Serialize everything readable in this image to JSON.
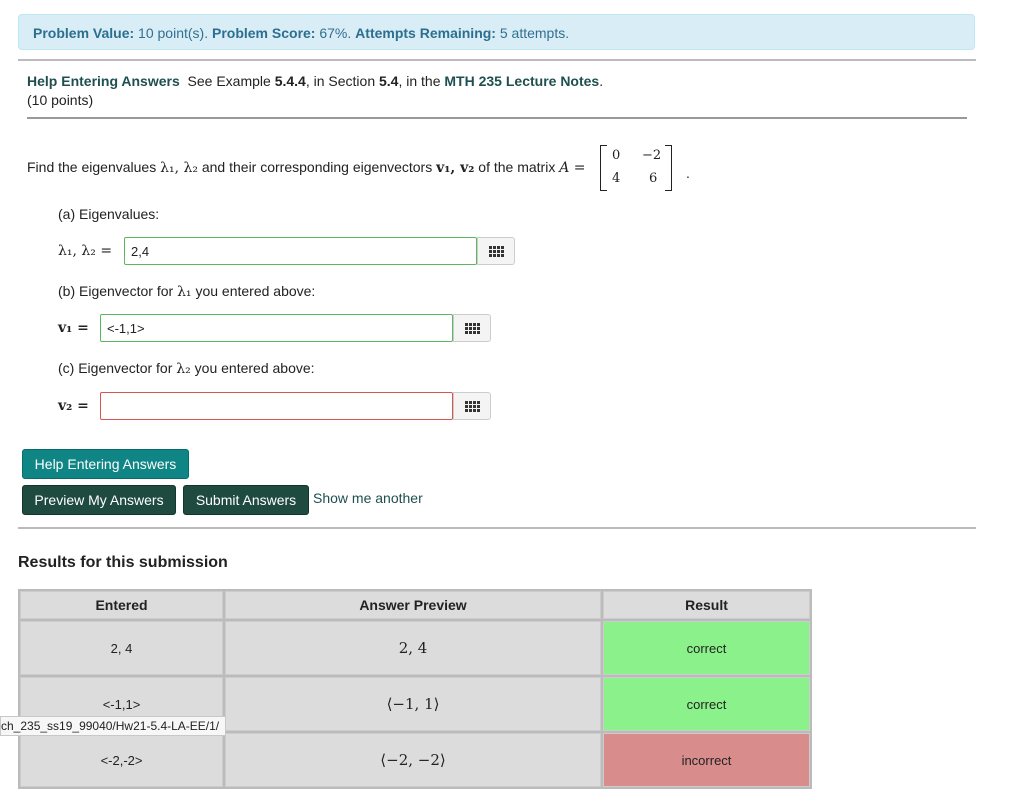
{
  "info_bar": {
    "value_label": "Problem Value:",
    "value_text": "10 point(s).",
    "score_label": "Problem Score:",
    "score_text": "67%.",
    "attempts_label": "Attempts Remaining:",
    "attempts_text": "5 attempts."
  },
  "problem_header": {
    "help_link": "Help Entering Answers",
    "see_text": "See Example",
    "example_ref": "5.4.4",
    "in_section_text": ", in Section",
    "section_ref": "5.4",
    "in_the_text": ", in the",
    "notes_link": "MTH 235 Lecture Notes",
    "period": ".",
    "points": "(10 points)"
  },
  "question": {
    "prefix": "Find the eigenvalues",
    "lambdas": "λ₁, λ₂",
    "mid": "and their corresponding eigenvectors",
    "vectors": "v₁, v₂",
    "suffix": "of the matrix",
    "matrix_var": "A =",
    "matrix": [
      [
        "0",
        "−2"
      ],
      [
        "4",
        "6"
      ]
    ],
    "end": "."
  },
  "parts": {
    "a_label": "(a) Eigenvalues:",
    "a_math": "λ₁, λ₂ =",
    "a_value": "2,4",
    "b_label_pre": "(b) Eigenvector for",
    "b_label_math": "λ₁",
    "b_label_post": "you entered above:",
    "b_math": "v₁ =",
    "b_value": "<-1,1>",
    "c_label_pre": "(c) Eigenvector for",
    "c_label_math": "λ₂",
    "c_label_post": "you entered above:",
    "c_math": "v₂ =",
    "c_value": ""
  },
  "buttons": {
    "help": "Help Entering Answers",
    "preview": "Preview My Answers",
    "submit": "Submit Answers",
    "show_another": "Show me another"
  },
  "results": {
    "title": "Results for this submission",
    "headers": [
      "Entered",
      "Answer Preview",
      "Result"
    ],
    "rows": [
      {
        "entered": "2, 4",
        "preview": "2, 4",
        "result": "correct"
      },
      {
        "entered": "<-1,1>",
        "preview": "⟨−1, 1⟩",
        "result": "correct"
      },
      {
        "entered": "<-2,-2>",
        "preview": "⟨−2, −2⟩",
        "result": "incorrect"
      }
    ]
  },
  "status_url": "ch_235_ss19_99040/Hw21-5.4-LA-EE/1/"
}
